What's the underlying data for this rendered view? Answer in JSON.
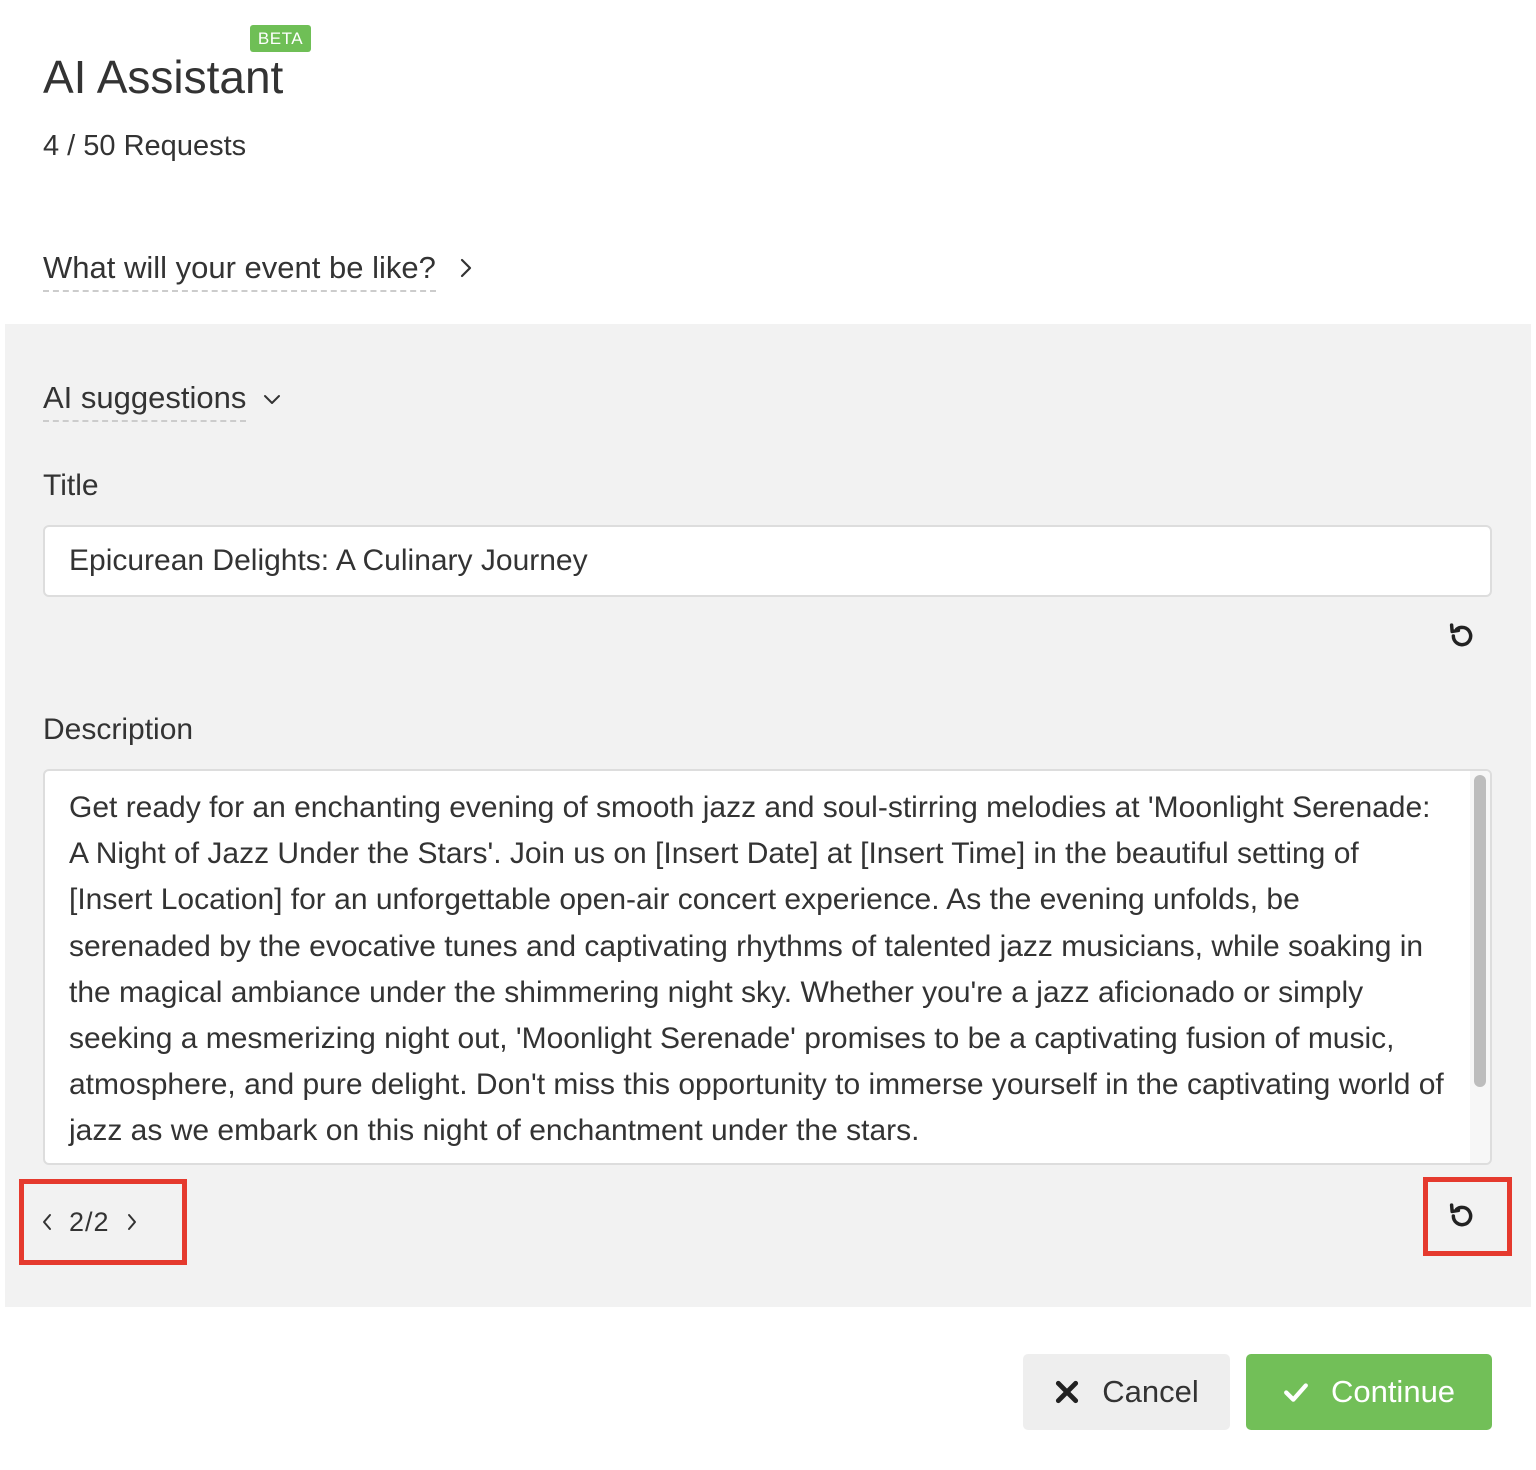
{
  "header": {
    "beta_badge": "BETA",
    "title": "AI Assistant",
    "requests": "4 / 50 Requests",
    "prompt_toggle": "What will your event be like?"
  },
  "suggestions": {
    "toggle_label": "AI suggestions",
    "title_label": "Title",
    "title_value": "Epicurean Delights: A Culinary Journey",
    "description_label": "Description",
    "description_value": "Get ready for an enchanting evening of smooth jazz and soul-stirring melodies at 'Moonlight Serenade: A Night of Jazz Under the Stars'. Join us on [Insert Date] at [Insert Time] in the beautiful setting of [Insert Location] for an unforgettable open-air concert experience. As the evening unfolds, be serenaded by the evocative tunes and captivating rhythms of talented jazz musicians, while soaking in the magical ambiance under the shimmering night sky. Whether you're a jazz aficionado or simply seeking a mesmerizing night out, 'Moonlight Serenade' promises to be a captivating fusion of music, atmosphere, and pure delight. Don't miss this opportunity to immerse yourself in the captivating world of jazz as we embark on this night of enchantment under the stars.",
    "pager": {
      "current": "2",
      "separator": "/",
      "total": "2"
    }
  },
  "footer": {
    "cancel_label": "Cancel",
    "continue_label": "Continue"
  },
  "icons": {
    "prompt_chevron": "chevron-right-icon",
    "suggestions_chevron": "chevron-down-icon",
    "regenerate": "rotate-ccw-icon",
    "cancel": "x-icon",
    "continue": "check-icon"
  },
  "colors": {
    "accent_green": "#72bf58",
    "beta_green": "#6fbf56",
    "highlight_red": "#e53a2e",
    "panel_bg": "#f2f2f2"
  }
}
